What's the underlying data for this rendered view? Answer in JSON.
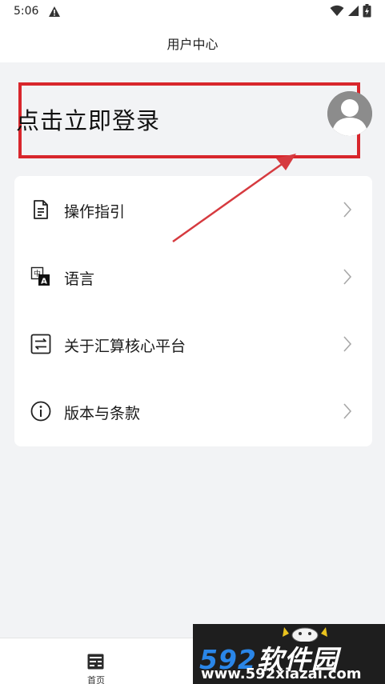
{
  "status_bar": {
    "time": "5:06"
  },
  "header": {
    "title": "用户中心"
  },
  "login": {
    "prompt": "点击立即登录"
  },
  "menu": {
    "items": [
      {
        "label": "操作指引",
        "icon": "document-icon"
      },
      {
        "label": "语言",
        "icon": "language-icon"
      },
      {
        "label": "关于汇算核心平台",
        "icon": "swap-arrows-icon"
      },
      {
        "label": "版本与条款",
        "icon": "info-icon"
      }
    ]
  },
  "bottom_nav": {
    "items": [
      {
        "label": "首页",
        "icon": "home-icon"
      }
    ]
  },
  "watermark": {
    "brand_number": "592",
    "brand_text": "软件园",
    "url": "www.592xiazai.com"
  },
  "colors": {
    "highlight": "#d8262c",
    "background": "#f2f3f5",
    "watermark_bg": "#1e1e1e",
    "watermark_accent": "#2a86e8"
  }
}
